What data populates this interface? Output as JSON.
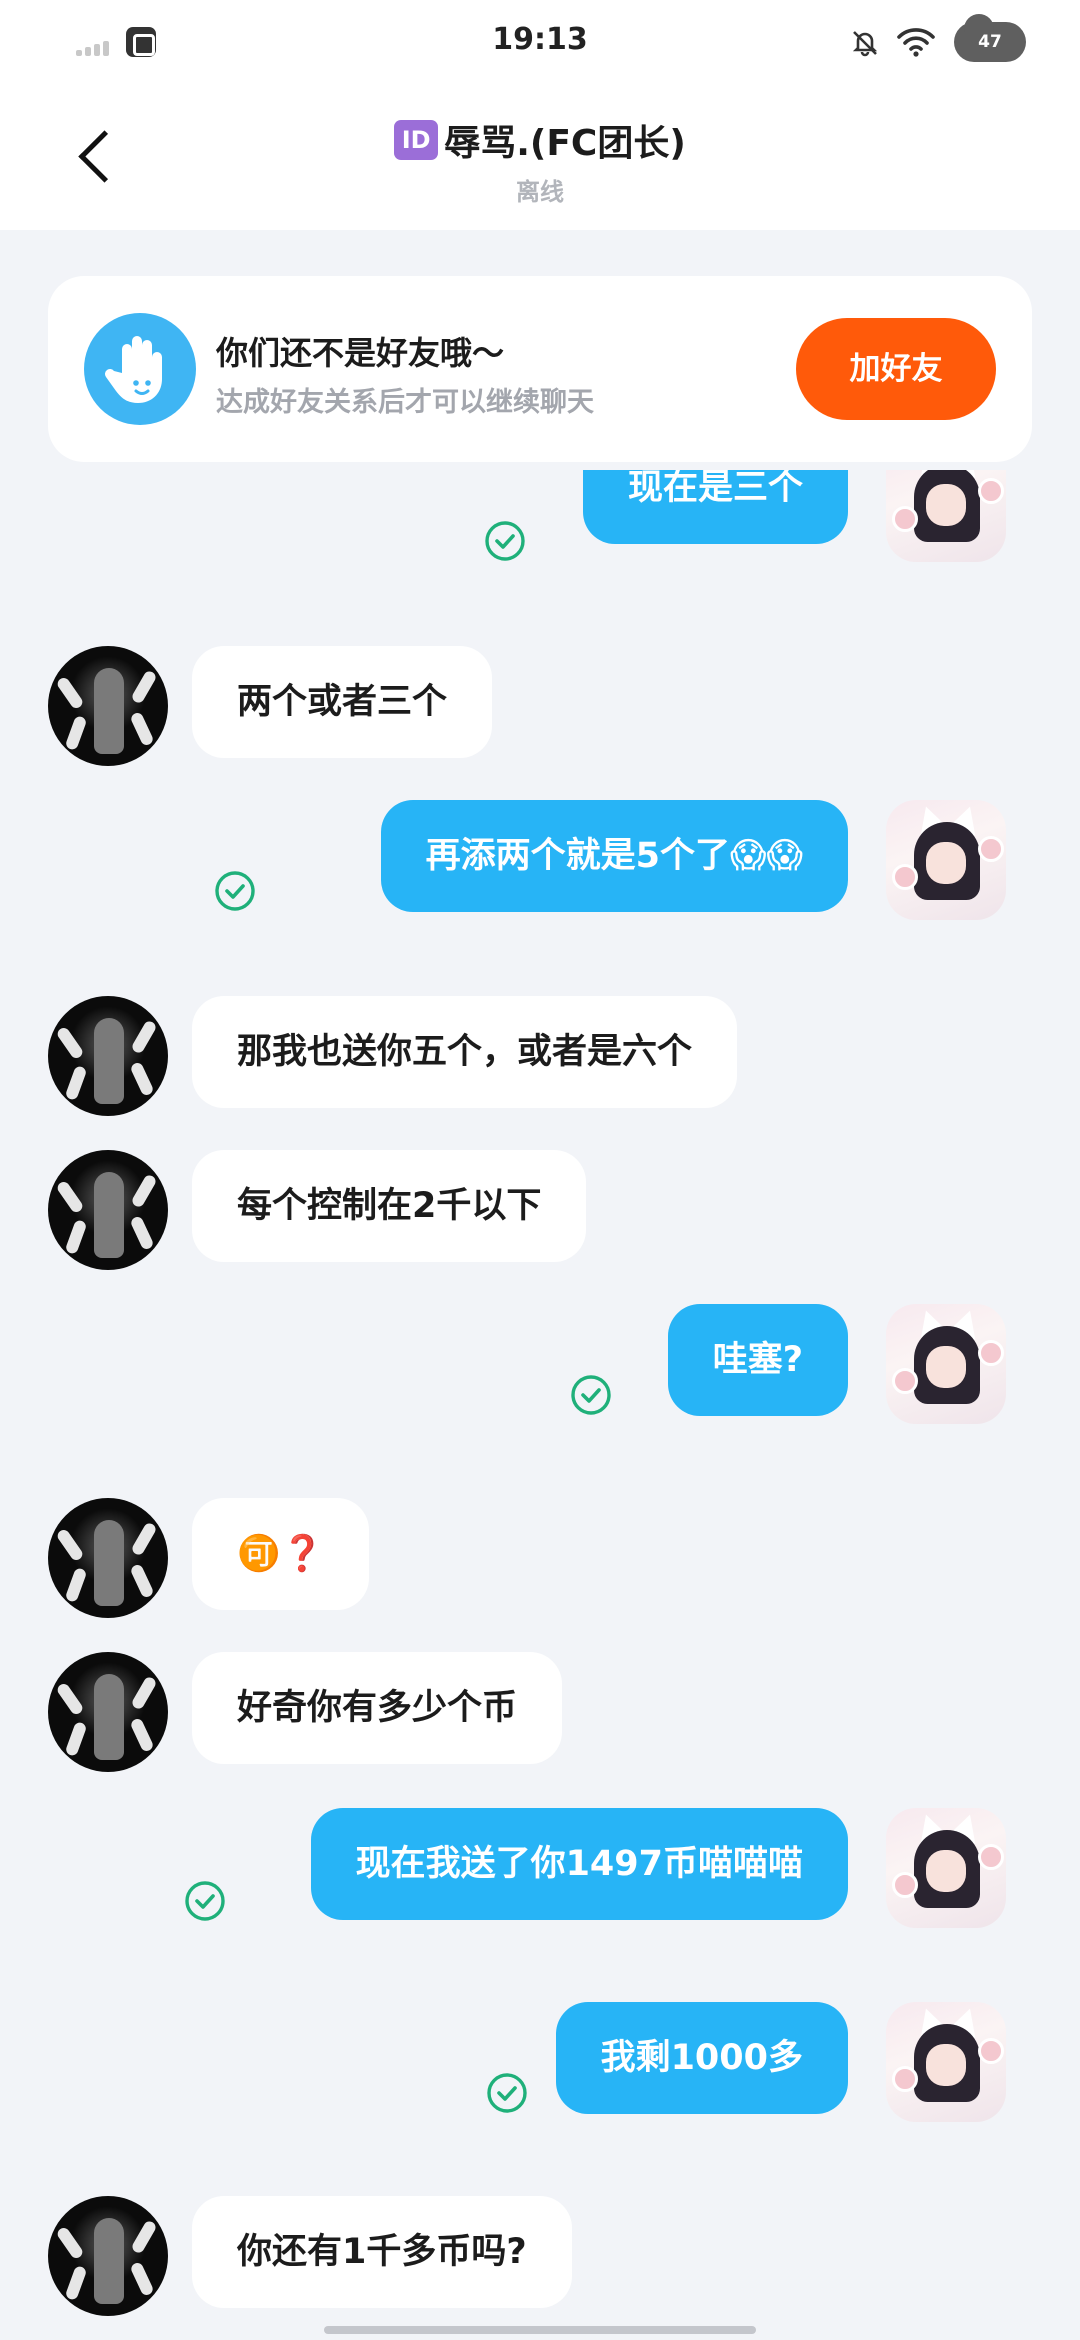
{
  "status_bar": {
    "time": "19:13",
    "battery_level": "47",
    "icons": [
      "signal-icon",
      "app-notification-icon",
      "bell-muted-icon",
      "wifi-icon",
      "cloud-battery-icon"
    ]
  },
  "header": {
    "id_badge": "ID",
    "title": "辱骂.(FC团长)",
    "status": "离线"
  },
  "friend_card": {
    "title": "你们还不是好友哦～",
    "subtitle": "达成好友关系后才可以继续聊天",
    "button": "加好友"
  },
  "messages": [
    {
      "side": "out",
      "text": "现在是三个"
    },
    {
      "side": "in",
      "text": "两个或者三个"
    },
    {
      "side": "out",
      "text": "再添两个就是5个了😱😱"
    },
    {
      "side": "in",
      "text": "那我也送你五个，或者是六个"
    },
    {
      "side": "in",
      "text": "每个控制在2千以下"
    },
    {
      "side": "out",
      "text": "哇塞?"
    },
    {
      "side": "in",
      "text": "🉑❓"
    },
    {
      "side": "in",
      "text": "好奇你有多少个币"
    },
    {
      "side": "out",
      "text": "现在我送了你1497币喵喵喵"
    },
    {
      "side": "out",
      "text": "我剩1000多"
    },
    {
      "side": "in",
      "text": "你还有1千多币吗?"
    }
  ],
  "colors": {
    "accent_blue": "#27b4f6",
    "add_button": "#ff5a0a",
    "background": "#f2f4f8",
    "read_check": "#1fb07a"
  }
}
